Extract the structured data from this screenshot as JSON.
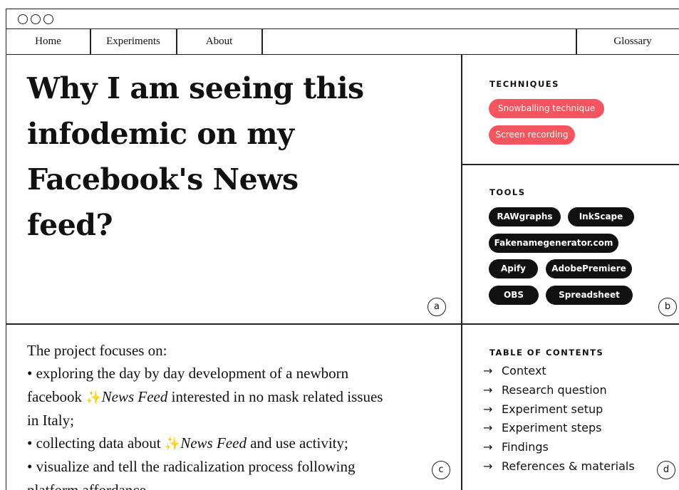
{
  "window": {
    "controls": [
      "window-dot",
      "window-dot",
      "window-dot"
    ]
  },
  "nav": {
    "home": "Home",
    "experiments": "Experiments",
    "about": "About",
    "glossary": "Glossary"
  },
  "hero": {
    "title_lines": [
      "Why I am seeing this",
      "infodemic on my",
      "Facebook's News",
      "feed?"
    ],
    "marker": "a"
  },
  "techniques": {
    "label": "TECHNIQUES",
    "items": [
      "Snowballing technique",
      "Screen recording"
    ],
    "color": "#f4555f"
  },
  "tools": {
    "label": "TOOLS",
    "items": [
      "RAWgraphs",
      "InkScape",
      "Fakenamegenerator.com",
      "Apify",
      "AdobePremiere",
      "OBS",
      "Spreadsheet"
    ],
    "marker": "b"
  },
  "description": {
    "intro": "The project focuses on:",
    "bullet1_a": "• exploring the day by day development of a newborn",
    "bullet1_b": "facebook ",
    "bullet1_c": "News Feed",
    "bullet1_d": " interested in no mask related issues",
    "bullet1_e": "in Italy;",
    "bullet2_a": "• collecting data about ",
    "bullet2_b": "News Feed",
    "bullet2_c": " and use activity;",
    "bullet3_a": "• visualize and tell the radicalization process following",
    "bullet3_b": "platform affordance.",
    "sparkle": "✨",
    "marker": "c"
  },
  "toc": {
    "label": "TABLE OF CONTENTS",
    "arrow": "→",
    "items": [
      "Context",
      "Research question",
      "Experiment setup",
      "Experiment steps",
      "Findings",
      "References & materials"
    ],
    "marker": "d"
  }
}
